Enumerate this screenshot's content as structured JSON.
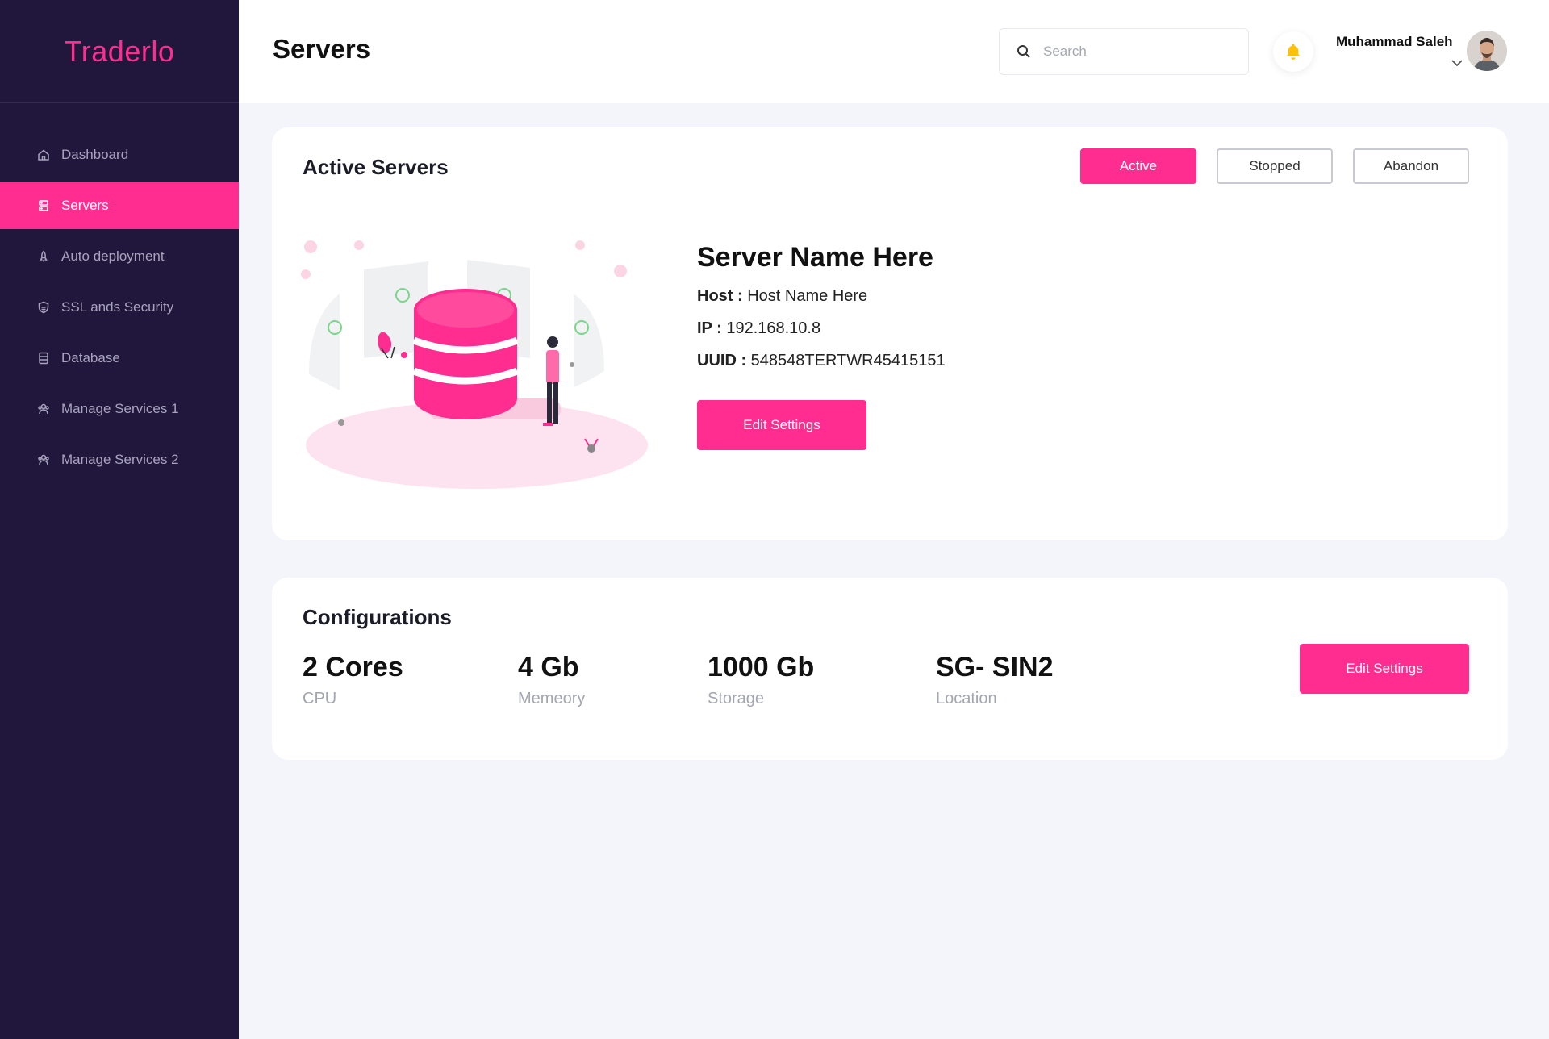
{
  "brand": {
    "name": "Traderlo",
    "color": "#ff2d8f"
  },
  "sidebar": {
    "items": [
      {
        "label": "Dashboard",
        "icon": "home-icon",
        "active": false
      },
      {
        "label": "Servers",
        "icon": "server-icon",
        "active": true
      },
      {
        "label": "Auto deployment",
        "icon": "rocket-icon",
        "active": false
      },
      {
        "label": "SSL ands Security",
        "icon": "shield-icon",
        "active": false
      },
      {
        "label": "Database",
        "icon": "database-icon",
        "active": false
      },
      {
        "label": "Manage Services 1",
        "icon": "users-icon",
        "active": false
      },
      {
        "label": "Manage Services 2",
        "icon": "users-icon",
        "active": false
      }
    ]
  },
  "header": {
    "title": "Servers",
    "search_placeholder": "Search",
    "user_name": "Muhammad Saleh"
  },
  "active_servers": {
    "title": "Active Servers",
    "filters": {
      "active": "Active",
      "stopped": "Stopped",
      "abandon": "Abandon"
    },
    "server_name": "Server Name Here",
    "host_label": "Host :",
    "host_value": "Host Name Here",
    "ip_label": "IP :",
    "ip_value": "192.168.10.8",
    "uuid_label": "UUID :",
    "uuid_value": "548548TERTWR45415151",
    "edit_label": "Edit Settings"
  },
  "configurations": {
    "title": "Configurations",
    "cpu": {
      "value": "2 Cores",
      "label": "CPU"
    },
    "memory": {
      "value": "4 Gb",
      "label": "Memeory"
    },
    "storage": {
      "value": "1000 Gb",
      "label": "Storage"
    },
    "location": {
      "value": "SG- SIN2",
      "label": "Location"
    },
    "edit_label": "Edit Settings"
  },
  "colors": {
    "accent": "#ff2d8f",
    "sidebar_bg": "#21173d",
    "page_bg": "#f3f5fa"
  }
}
